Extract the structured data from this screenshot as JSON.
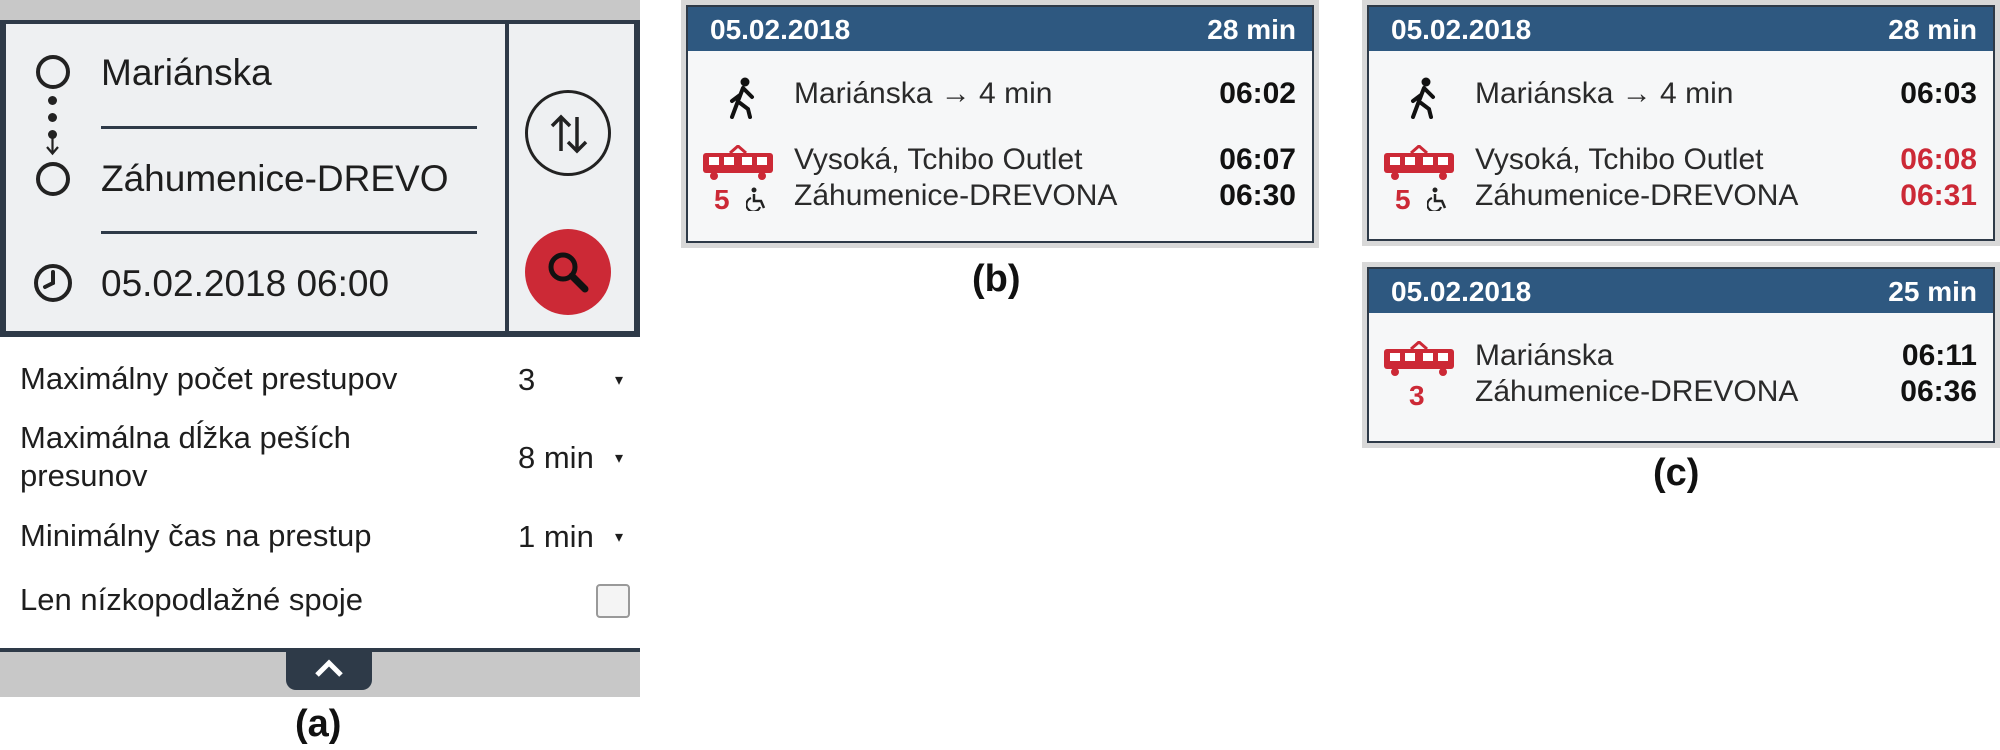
{
  "panel_a": {
    "from": "Mariánska",
    "to": "Záhumenice-DREVO",
    "datetime": "05.02.2018 06:00",
    "options": [
      {
        "label": "Maximálny počet prestupov",
        "value": "3"
      },
      {
        "label": "Maximálna dĺžka peších presunov",
        "value": "8 min"
      },
      {
        "label": "Minimálny čas na prestup",
        "value": "1 min"
      }
    ],
    "low_floor_label": "Len nízkopodlažné spoje",
    "caret": "▾",
    "caption": "(a)"
  },
  "panel_b": {
    "caption": "(b)",
    "card": {
      "date": "05.02.2018",
      "duration": "28 min",
      "walk": {
        "text": "Mariánska → 4 min",
        "time": "06:02"
      },
      "tram": {
        "line": "5",
        "from": "Vysoká, Tchibo Outlet",
        "from_time": "06:07",
        "to": "Záhumenice-DREVONA",
        "to_time": "06:30"
      }
    }
  },
  "panel_c": {
    "caption": "(c)",
    "card1": {
      "date": "05.02.2018",
      "duration": "28 min",
      "walk": {
        "text": "Mariánska → 4 min",
        "time": "06:03"
      },
      "tram": {
        "line": "5",
        "from": "Vysoká, Tchibo Outlet",
        "from_time": "06:08",
        "to": "Záhumenice-DREVONA",
        "to_time": "06:31"
      }
    },
    "card2": {
      "date": "05.02.2018",
      "duration": "25 min",
      "tram": {
        "line": "3",
        "from": "Mariánska",
        "from_time": "06:11",
        "to": "Záhumenice-DREVONA",
        "to_time": "06:36"
      }
    }
  },
  "colors": {
    "header_blue": "#2e5880",
    "dark_navy": "#2e3a48",
    "accent_red": "#cc2936",
    "panel_bg": "#eef0f2"
  },
  "icons": [
    "circle-stop-icon",
    "arrow-down-icon",
    "clock-icon",
    "swap-icon",
    "search-icon",
    "chevron-up-icon",
    "walk-icon",
    "tram-icon",
    "wheelchair-icon"
  ]
}
